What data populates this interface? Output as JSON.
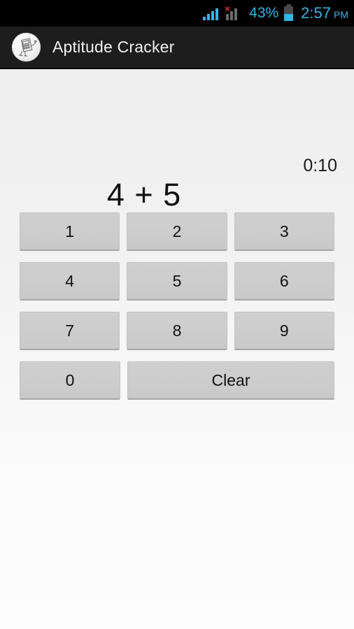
{
  "status_bar": {
    "signal_primary_icon": "signal-bars-icon",
    "signal_secondary_icon": "signal-bars-disabled-icon",
    "signal_error_glyph": "×",
    "battery_percent": "43%",
    "battery_icon": "battery-icon",
    "battery_level": 43,
    "time": "2:57",
    "am_pm": "PM",
    "accent_color": "#33b5e5"
  },
  "action_bar": {
    "app_icon": "calculator-mascot-icon",
    "title": "Aptitude Cracker",
    "background_color": "#1d1d1d"
  },
  "main": {
    "timer": "0:10",
    "question": "4 + 5",
    "background_color": "#efefef",
    "keypad": {
      "rows": [
        {
          "keys": [
            {
              "label": "1",
              "name": "key-1",
              "wide": false
            },
            {
              "label": "2",
              "name": "key-2",
              "wide": false
            },
            {
              "label": "3",
              "name": "key-3",
              "wide": false
            }
          ]
        },
        {
          "keys": [
            {
              "label": "4",
              "name": "key-4",
              "wide": false
            },
            {
              "label": "5",
              "name": "key-5",
              "wide": false
            },
            {
              "label": "6",
              "name": "key-6",
              "wide": false
            }
          ]
        },
        {
          "keys": [
            {
              "label": "7",
              "name": "key-7",
              "wide": false
            },
            {
              "label": "8",
              "name": "key-8",
              "wide": false
            },
            {
              "label": "9",
              "name": "key-9",
              "wide": false
            }
          ]
        },
        {
          "keys": [
            {
              "label": "0",
              "name": "key-0",
              "wide": false
            },
            {
              "label": "Clear",
              "name": "key-clear",
              "wide": true
            }
          ]
        }
      ],
      "key_color": "#cdcdcd"
    }
  }
}
